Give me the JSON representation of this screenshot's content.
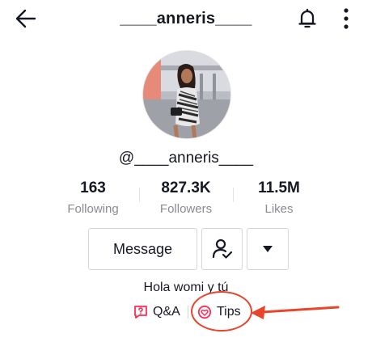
{
  "header": {
    "title": "____anneris____"
  },
  "profile": {
    "handle": "@____anneris____",
    "bio": "Hola womi y tú"
  },
  "stats": [
    {
      "value": "163",
      "label": "Following"
    },
    {
      "value": "827.3K",
      "label": "Followers"
    },
    {
      "value": "11.5M",
      "label": "Likes"
    }
  ],
  "actions": {
    "message_label": "Message"
  },
  "links": {
    "qa_label": "Q&A",
    "tips_label": "Tips"
  },
  "colors": {
    "accent": "#fe2c55",
    "annotation": "#e8452a",
    "text": "#161823",
    "muted": "#8a8b91"
  },
  "icons": [
    "back-arrow-icon",
    "bell-icon",
    "more-vertical-icon",
    "user-check-icon",
    "caret-down-icon",
    "qa-icon",
    "tips-icon"
  ]
}
